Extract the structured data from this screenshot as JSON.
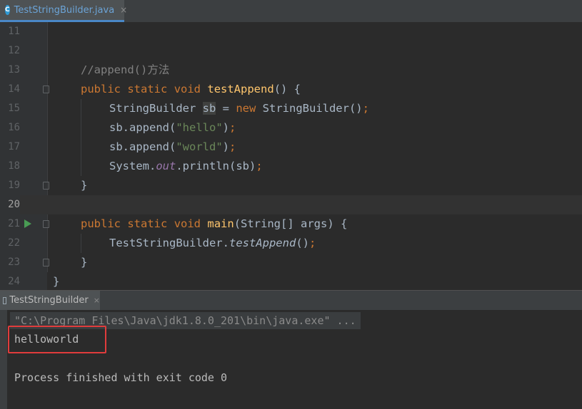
{
  "editor_tab": {
    "label": "TestStringBuilder.java",
    "close": "×",
    "icon": "java-class-icon"
  },
  "editor": {
    "lines": [
      {
        "num": "11"
      },
      {
        "num": "12"
      },
      {
        "num": "13",
        "comment": "//append()方法"
      },
      {
        "num": "14",
        "t1": "public",
        "t2": "static",
        "t3": "void",
        "fn": "testAppend",
        "rest": "() {"
      },
      {
        "num": "15",
        "a": "StringBuilder ",
        "var": "sb",
        "b": " = ",
        "kw": "new",
        "c": " StringBuilder()",
        "semi": ";"
      },
      {
        "num": "16",
        "a": "sb.append(",
        "str": "\"hello\"",
        "b": ")",
        "semi": ";"
      },
      {
        "num": "17",
        "a": "sb.append(",
        "str": "\"world\"",
        "b": ")",
        "semi": ";"
      },
      {
        "num": "18",
        "a": "System.",
        "field": "out",
        "b": ".println(sb)",
        "semi": ";"
      },
      {
        "num": "19",
        "a": "}"
      },
      {
        "num": "20"
      },
      {
        "num": "21",
        "t1": "public",
        "t2": "static",
        "t3": "void",
        "fn": "main",
        "rest": "(String[] args) {"
      },
      {
        "num": "22",
        "a": "TestStringBuilder.",
        "call": "testAppend",
        "b": "()",
        "semi": ";"
      },
      {
        "num": "23",
        "a": "}"
      },
      {
        "num": "24",
        "a": "}"
      }
    ]
  },
  "run_tab": {
    "label": "TestStringBuilder",
    "close": "×"
  },
  "console": {
    "command": "\"C:\\Program Files\\Java\\jdk1.8.0_201\\bin\\java.exe\" ...",
    "output": "helloworld",
    "exit": "Process finished with exit code 0"
  }
}
